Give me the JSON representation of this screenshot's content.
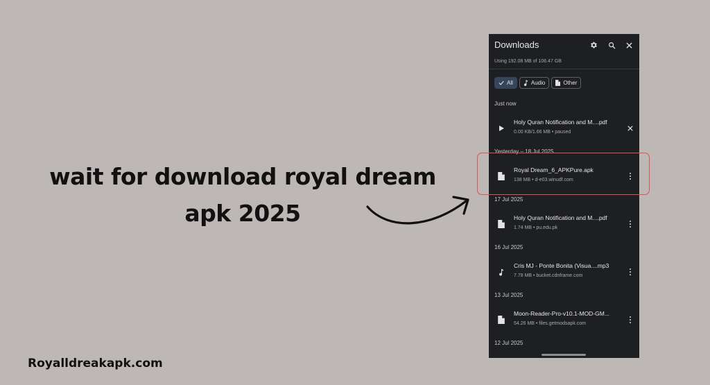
{
  "caption": {
    "line1": "wait for download royal dream",
    "line2": "apk 2025",
    "site": "Royalldreakapk.com"
  },
  "app": {
    "title": "Downloads",
    "usage": "Using 192.08 MB of 106.47 GB",
    "icons": [
      "gear-icon",
      "search-icon",
      "close-icon"
    ],
    "filters": [
      {
        "label": "All",
        "icon": "check-icon",
        "selected": true
      },
      {
        "label": "Audio",
        "icon": "music-note-icon",
        "selected": false
      },
      {
        "label": "Other",
        "icon": "file-icon",
        "selected": false
      }
    ],
    "sections": [
      {
        "label": "Just now",
        "items": [
          {
            "title": "Holy Quran Notification and M....pdf",
            "subtitle": "0.00 KB/1.66 MB • paused",
            "icon": "play-icon",
            "action": "close-icon"
          }
        ]
      },
      {
        "label": "Yesterday – 18 Jul 2025",
        "items": [
          {
            "title": "Royal Dream_6_APKPure.apk",
            "subtitle": "138 MB • d-e03.winudf.com",
            "icon": "file-icon",
            "action": "more-icon",
            "highlighted": true
          }
        ]
      },
      {
        "label": "17 Jul 2025",
        "items": [
          {
            "title": "Holy Quran Notification and M....pdf",
            "subtitle": "1.74 MB • pu.edu.pk",
            "icon": "file-icon",
            "action": "more-icon"
          }
        ]
      },
      {
        "label": "16 Jul 2025",
        "items": [
          {
            "title": "Cris MJ - Ponte Bonita (Visua....mp3",
            "subtitle": "7.78 MB • bucket.cdnframe.com",
            "icon": "music-note-icon",
            "action": "more-icon"
          }
        ]
      },
      {
        "label": "13 Jul 2025",
        "items": [
          {
            "title": "Moon-Reader-Pro-v10.1-MOD-GM...",
            "subtitle": "54.26 MB • files.getmodsapk.com",
            "icon": "file-icon",
            "action": "more-icon"
          }
        ]
      },
      {
        "label": "12 Jul 2025",
        "items": []
      }
    ]
  },
  "colors": {
    "background": "#bdb7b6",
    "panel": "#1e1f22",
    "highlight": "#e2534c",
    "chip_selected": "#36445c"
  }
}
